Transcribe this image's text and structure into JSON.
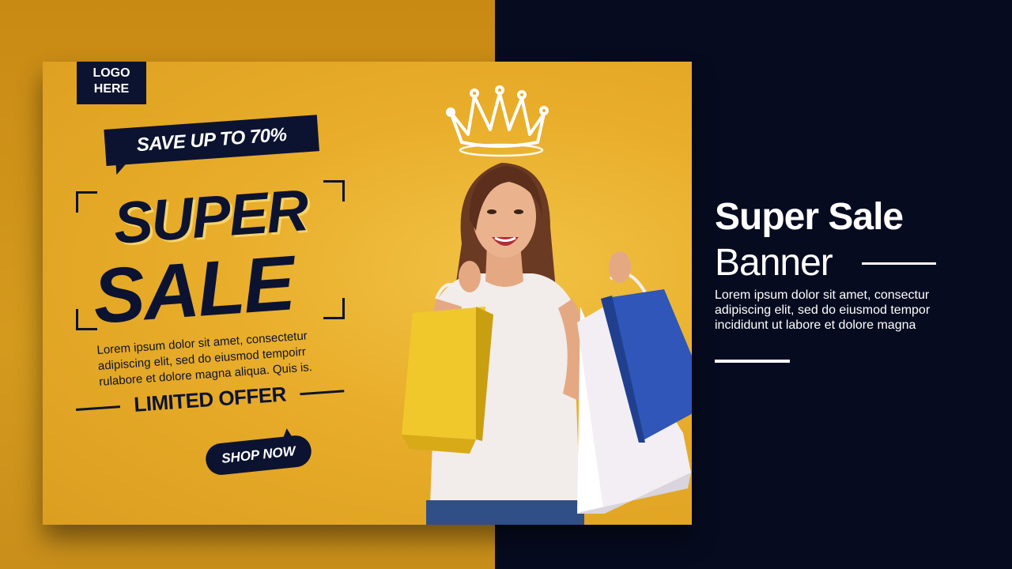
{
  "banner": {
    "logo_line1": "LOGO",
    "logo_line2": "HERE",
    "save_tag": "SAVE UP TO 70%",
    "headline_1": "SUPER",
    "headline_2": "SALE",
    "description": "Lorem ipsum dolor sit amet, consectetur adipiscing elit, sed do eiusmod tempoirr rulabore et dolore magna aliqua. Quis is.",
    "limited_offer": "LIMITED OFFER",
    "shop_button": "SHOP NOW",
    "photo_alt_icon": "woman-with-shopping-bags-photo",
    "crown_icon": "crown-icon"
  },
  "side": {
    "title": "Super Sale",
    "subtitle": "Banner",
    "description": "Lorem ipsum dolor sit amet, consectur adipiscing elit, sed do eiusmod tempor incididunt ut labore et dolore magna"
  },
  "colors": {
    "yellow": "#e8ad2a",
    "navy": "#0c1330",
    "dark_bg": "#060b1f",
    "white": "#ffffff"
  }
}
